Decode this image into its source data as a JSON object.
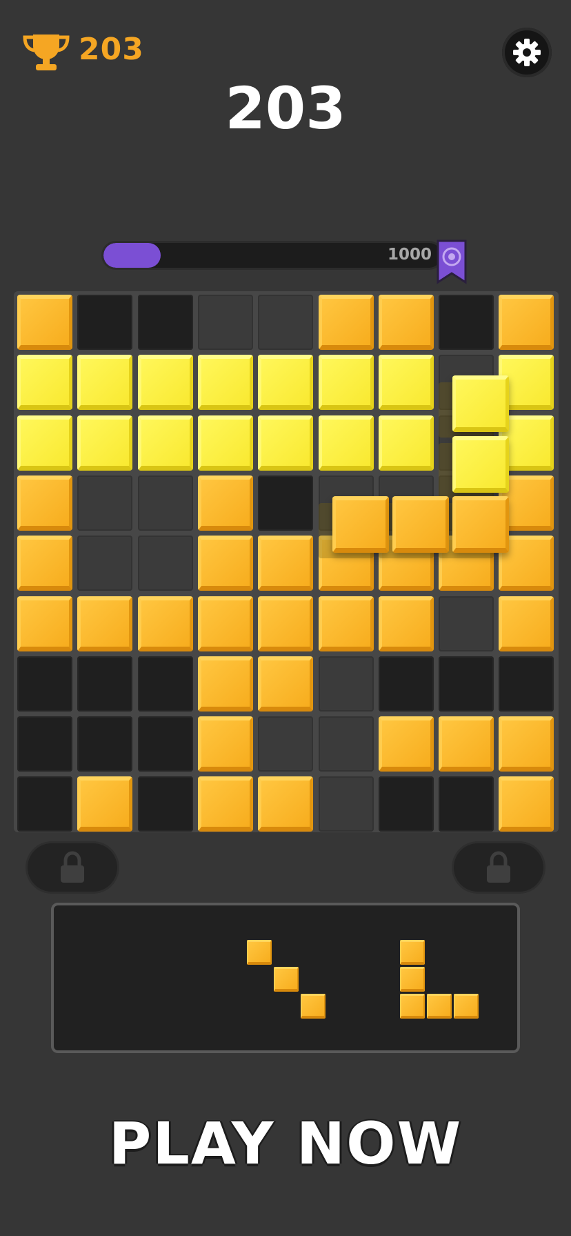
{
  "header": {
    "best_score": "203",
    "best_icon": "trophy-icon",
    "settings_icon": "gear-icon",
    "current_score": "203"
  },
  "progress": {
    "value": 203,
    "goal": "1000",
    "fill_fraction": 0.17,
    "goal_icon": "target-bookmark-icon",
    "fill_color": "#7b4fd4"
  },
  "board": {
    "rows": 9,
    "cols": 9,
    "cells": [
      [
        "o",
        "d",
        "d",
        "g",
        "g",
        "o",
        "o",
        "d",
        "o"
      ],
      [
        "y",
        "y",
        "y",
        "y",
        "y",
        "y",
        "y",
        "g",
        "y"
      ],
      [
        "y",
        "y",
        "y",
        "y",
        "y",
        "y",
        "y",
        "g",
        "y"
      ],
      [
        "o",
        "g",
        "g",
        "o",
        "d",
        "g",
        "g",
        "g",
        "o"
      ],
      [
        "o",
        "g",
        "g",
        "o",
        "o",
        "o",
        "o",
        "o",
        "o"
      ],
      [
        "o",
        "o",
        "o",
        "o",
        "o",
        "o",
        "o",
        "g",
        "o"
      ],
      [
        "d",
        "d",
        "d",
        "o",
        "o",
        "g",
        "d",
        "d",
        "d"
      ],
      [
        "d",
        "d",
        "d",
        "o",
        "g",
        "g",
        "o",
        "o",
        "o"
      ],
      [
        "d",
        "o",
        "d",
        "o",
        "o",
        "g",
        "d",
        "d",
        "o"
      ]
    ],
    "colors": {
      "orange": "#f7ad1e",
      "yellow": "#f9e931",
      "empty_dark": "#1f1f1f",
      "empty_grey": "#3b3b3b"
    }
  },
  "dragged_piece": {
    "shape": "L",
    "blocks": [
      {
        "row": 1,
        "col": 7,
        "color": "yellow"
      },
      {
        "row": 2,
        "col": 7,
        "color": "yellow"
      },
      {
        "row": 3,
        "col": 5,
        "color": "orange"
      },
      {
        "row": 3,
        "col": 6,
        "color": "orange"
      },
      {
        "row": 3,
        "col": 7,
        "color": "orange"
      }
    ]
  },
  "locks": {
    "left_icon": "lock-icon",
    "right_icon": "lock-icon"
  },
  "tray": {
    "pieces": [
      {
        "name": "diagonal-piece",
        "blocks": [
          [
            0,
            0
          ],
          [
            1,
            1
          ],
          [
            2,
            2
          ]
        ]
      },
      {
        "name": "l-piece",
        "blocks": [
          [
            0,
            0
          ],
          [
            1,
            0
          ],
          [
            2,
            0
          ],
          [
            2,
            1
          ],
          [
            2,
            2
          ]
        ]
      }
    ]
  },
  "cta": {
    "label": "PLAY NOW"
  }
}
